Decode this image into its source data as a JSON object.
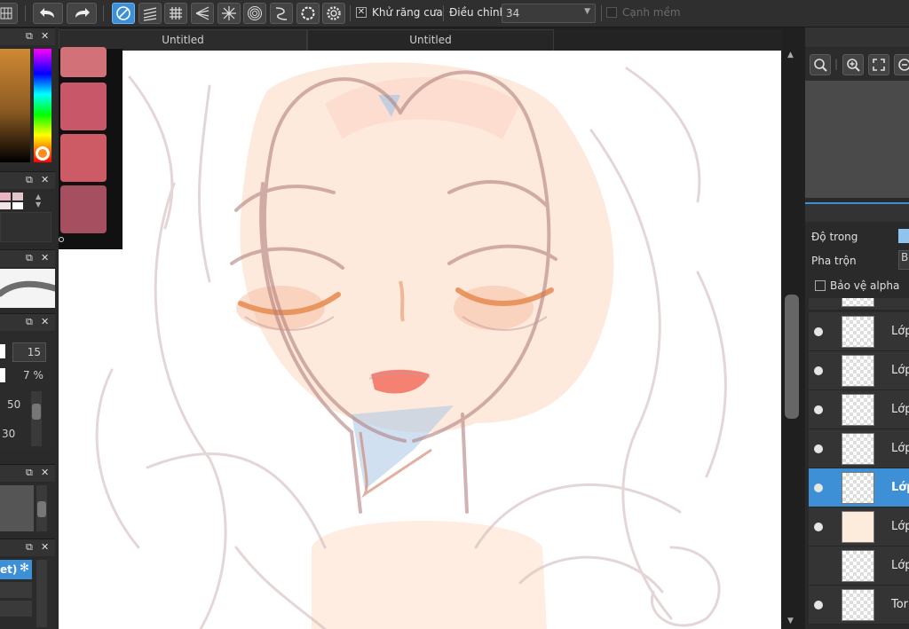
{
  "toolbar": {
    "antialias_label": "Khử răng cưa",
    "antialias_checked": true,
    "adjust_label": "Điều chỉnh",
    "adjust_value": "34",
    "soft_edge_label": "Cạnh mềm",
    "soft_edge_checked": false,
    "check_mark": "✕"
  },
  "tabs": [
    {
      "label": "Untitled"
    },
    {
      "label": "Untitled"
    }
  ],
  "left_panels": {
    "brush_size": "15",
    "brush_opacity": "7 %",
    "value_a": "50",
    "value_b": "30",
    "preset_label": "et)"
  },
  "swatch_colors": [
    "#d27178",
    "#c8576a",
    "#cc5b66",
    "#a64f61"
  ],
  "right_panel": {
    "opacity_label": "Độ trong",
    "blend_label": "Pha trộn",
    "blend_value": "B",
    "protect_alpha_label": "Bảo vệ alpha",
    "accent": "#3d8fd6"
  },
  "layers": [
    {
      "name": "Lớp",
      "visible": true,
      "selected": false
    },
    {
      "name": "Lớp",
      "visible": true,
      "selected": false
    },
    {
      "name": "Lớp",
      "visible": true,
      "selected": false
    },
    {
      "name": "Lớp",
      "visible": true,
      "selected": false
    },
    {
      "name": "Lớp",
      "visible": true,
      "selected": true
    },
    {
      "name": "Lớp",
      "visible": true,
      "selected": false
    },
    {
      "name": "Lớp",
      "visible": false,
      "selected": false
    },
    {
      "name": "Tor",
      "visible": true,
      "selected": false
    }
  ]
}
